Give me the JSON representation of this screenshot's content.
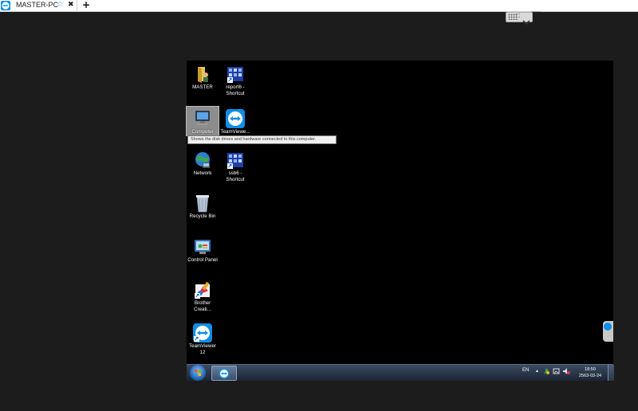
{
  "tab": {
    "title": "MASTER-PC",
    "star": "☆",
    "close": "✖",
    "add": "+"
  },
  "toolbar_handle": {
    "icon": "⛶"
  },
  "desktop": {
    "icons": [
      {
        "label": "MASTER",
        "icon": "user-folder-icon"
      },
      {
        "label": "report6 -\nShortcut",
        "icon": "app-shortcut-icon"
      },
      {
        "label": "Computer",
        "icon": "computer-icon"
      },
      {
        "label": "TeamViewe...",
        "icon": "teamviewer-icon"
      },
      {
        "label": "Network",
        "icon": "network-icon"
      },
      {
        "label": "ssb6 -\nShortcut",
        "icon": "app-shortcut-icon"
      },
      {
        "label": "Recycle Bin",
        "icon": "recycle-bin-icon"
      },
      {
        "label": "Control Panel",
        "icon": "control-panel-icon"
      },
      {
        "label": "Brother\nCreati...",
        "icon": "brother-icon"
      },
      {
        "label": "TeamViewer\n12",
        "icon": "teamviewer-icon"
      }
    ],
    "tooltip": "Shows the disk drives and hardware connected to this computer."
  },
  "taskbar": {
    "language": "EN",
    "tray_arrow": "▲",
    "time": "18:50",
    "date": "2563-03-24"
  },
  "colors": {
    "teamviewer_blue": "#0e8ee9",
    "taskbar_top": "#3b4b62",
    "desktop_bg": "#000000"
  }
}
